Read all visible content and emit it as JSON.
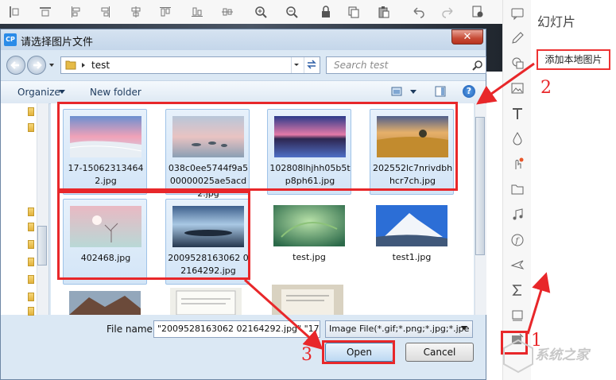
{
  "dialog": {
    "logo": "CP",
    "title": "请选择图片文件",
    "close": "✕"
  },
  "address": {
    "folder": "test",
    "search_placeholder": "Search test"
  },
  "commands": {
    "organize": "Organize",
    "new_folder": "New folder"
  },
  "files": [
    {
      "name": "17-150623134642.jpg",
      "selected": true
    },
    {
      "name": "038c0ee5744f9a500000025ae5acd2.jpg",
      "selected": true
    },
    {
      "name": "102808lhjhh05b5tp8ph61.jpg",
      "selected": true
    },
    {
      "name": "202552lc7nrivdbhhcr7ch.jpg",
      "selected": true
    },
    {
      "name": "402468.jpg",
      "selected": true
    },
    {
      "name": "2009528163062 02164292.jpg",
      "selected": true
    },
    {
      "name": "test.jpg",
      "selected": false
    },
    {
      "name": "test1.jpg",
      "selected": false
    }
  ],
  "filename": {
    "label": "File name:",
    "value": "\"2009528163062 02164292.jpg\" \"17-"
  },
  "filetype": "Image File(*.gif;*.png;*.jpg;*.jpe",
  "buttons": {
    "open": "Open",
    "cancel": "Cancel"
  },
  "panel": {
    "title": "幻灯片",
    "add_local": "添加本地图片"
  },
  "annotations": [
    "1",
    "2",
    "3"
  ],
  "watermark": "系统之家",
  "colors": {
    "annotation": "#e8272a",
    "selection": "#d3e5f7",
    "dialog_frame": "#dbe8f4"
  }
}
